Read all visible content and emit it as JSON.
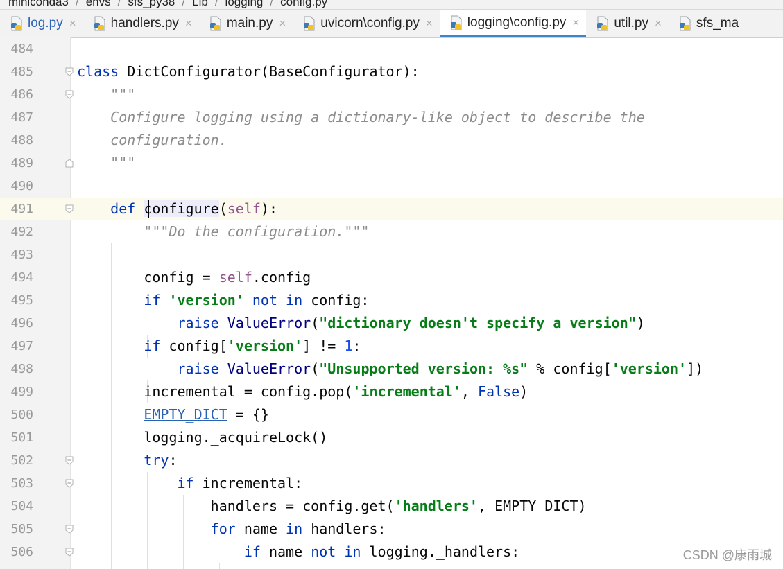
{
  "breadcrumb": [
    "miniconda3",
    "envs",
    "sfs_py38",
    "Lib",
    "logging",
    "config.py"
  ],
  "tabs": [
    {
      "label": "log.py"
    },
    {
      "label": "handlers.py"
    },
    {
      "label": "main.py"
    },
    {
      "label": "uvicorn\\config.py"
    },
    {
      "label": "logging\\config.py"
    },
    {
      "label": "util.py"
    },
    {
      "label": "sfs_ma"
    }
  ],
  "close_glyph": "×",
  "lines": [
    {
      "n": "484"
    },
    {
      "n": "485"
    },
    {
      "n": "486"
    },
    {
      "n": "487"
    },
    {
      "n": "488"
    },
    {
      "n": "489"
    },
    {
      "n": "490"
    },
    {
      "n": "491"
    },
    {
      "n": "492"
    },
    {
      "n": "493"
    },
    {
      "n": "494"
    },
    {
      "n": "495"
    },
    {
      "n": "496"
    },
    {
      "n": "497"
    },
    {
      "n": "498"
    },
    {
      "n": "499"
    },
    {
      "n": "500"
    },
    {
      "n": "501"
    },
    {
      "n": "502"
    },
    {
      "n": "503"
    },
    {
      "n": "504"
    },
    {
      "n": "505"
    },
    {
      "n": "506"
    }
  ],
  "code": {
    "l485": {
      "kw": "class",
      "rest": "DictConfigurator(BaseConfigurator):"
    },
    "l486": "\"\"\"",
    "l487": "Configure logging using a dictionary-like object to describe the",
    "l488": "configuration.",
    "l489": "\"\"\"",
    "l491": {
      "kw": "def",
      "name": "configure",
      "open": "(",
      "self": "self",
      "close": "):"
    },
    "l492": "\"\"\"Do the configuration.\"\"\"",
    "l494": {
      "a": "config = ",
      "self": "self",
      "b": ".config"
    },
    "l495": {
      "kw1": "if",
      "str": "'version'",
      "kw2": "not in",
      "rest": "config:"
    },
    "l496": {
      "kw": "raise",
      "cls": "ValueError",
      "open": "(",
      "str": "\"dictionary doesn't specify a version\"",
      "close": ")"
    },
    "l497": {
      "kw": "if",
      "a": "config[",
      "str": "'version'",
      "b": "] != ",
      "num": "1",
      "c": ":"
    },
    "l498": {
      "kw": "raise",
      "cls": "ValueError",
      "open": "(",
      "str": "\"Unsupported version: %s\"",
      "b": " % config[",
      "str2": "'version'",
      "c": "])"
    },
    "l499": {
      "a": "incremental = config.pop(",
      "str": "'incremental'",
      "b": ", ",
      "kw": "False",
      "c": ")"
    },
    "l500": {
      "link": "EMPTY_DICT",
      "rest": " = {}"
    },
    "l501": "logging._acquireLock()",
    "l502": {
      "kw": "try",
      "rest": ":"
    },
    "l503": {
      "kw": "if",
      "rest": "incremental:"
    },
    "l504": {
      "a": "handlers = config.get(",
      "str": "'handlers'",
      "b": ", EMPTY_DICT)"
    },
    "l505": {
      "kw1": "for",
      "a": "name",
      "kw2": "in",
      "b": "handlers:"
    },
    "l506": {
      "kw1": "if",
      "a": "name",
      "kw2": "not in",
      "b": "logging._handlers:"
    }
  },
  "watermark": "CSDN @康雨城",
  "colors": {
    "keyword": "#0033b3",
    "string": "#067d17",
    "docstring": "#8c8c8c",
    "self": "#94558d",
    "number": "#1750eb",
    "active_tab_underline": "#4083c9"
  }
}
